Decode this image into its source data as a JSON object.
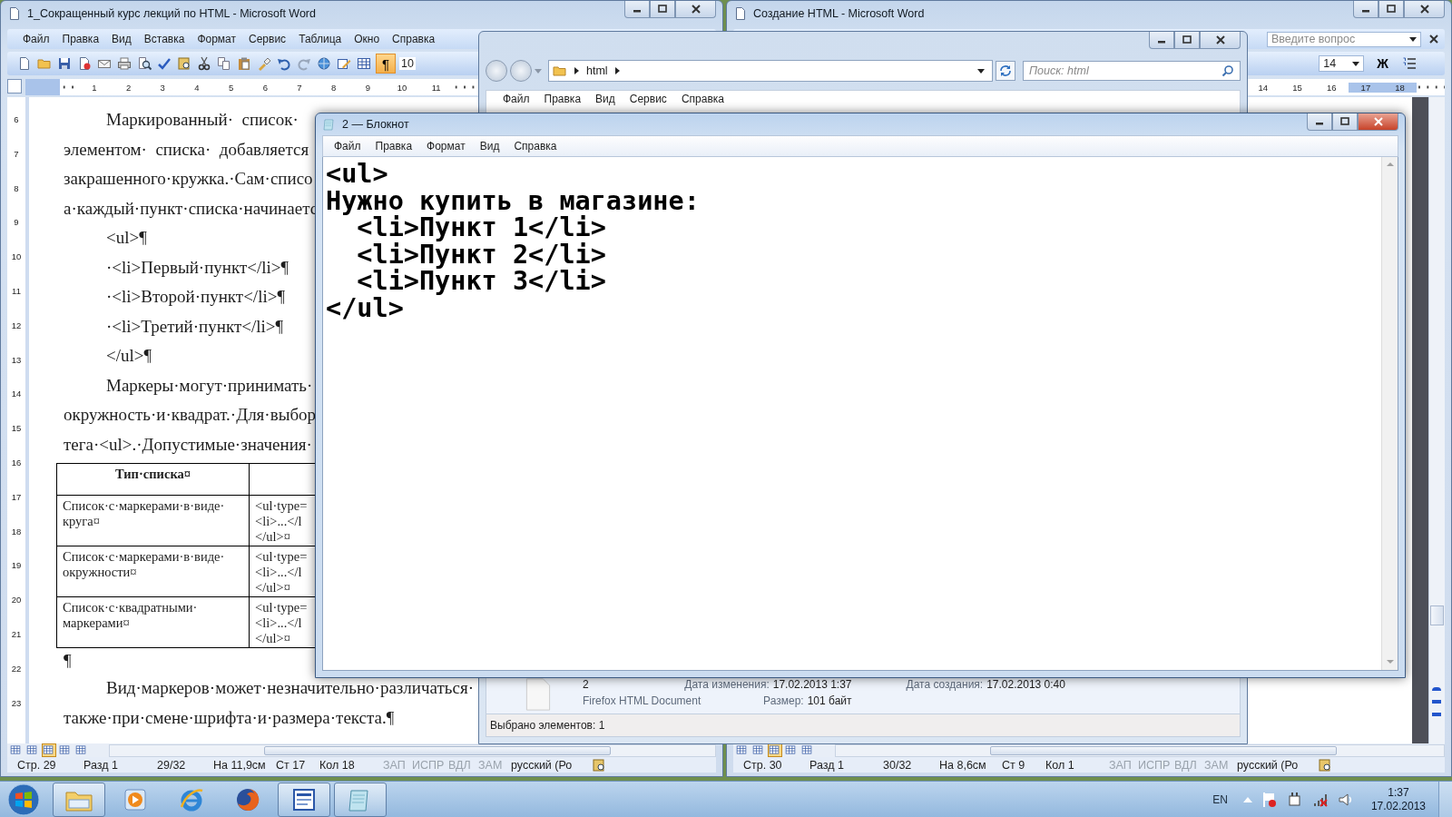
{
  "word_left": {
    "title": "1_Сокращенный курс лекций по HTML - Microsoft Word",
    "menu": [
      "Файл",
      "Правка",
      "Вид",
      "Вставка",
      "Формат",
      "Сервис",
      "Таблица",
      "Окно",
      "Справка"
    ],
    "show_marks": {
      "label": "¶",
      "on": true
    },
    "zoom": "10",
    "ruler": [
      "1",
      "2",
      "3",
      "4",
      "5",
      "6",
      "7",
      "8",
      "9",
      "10",
      "11"
    ],
    "vruler": [
      "6",
      "7",
      "8",
      "9",
      "10",
      "11",
      "12",
      "13",
      "14",
      "15",
      "16",
      "17",
      "18",
      "19",
      "20",
      "21",
      "22",
      "23"
    ],
    "lines_top": [
      {
        "text": "Маркированный·  список·",
        "indented": true
      },
      {
        "text": "элементом·  списка·  добавляется",
        "indented": false
      },
      {
        "text": "закрашенного·кружка.·Сам·списо",
        "indented": false
      },
      {
        "text": "а·каждый·пункт·списка·начинаетс",
        "indented": false
      },
      {
        "text": "<ul>¶",
        "indented": true
      },
      {
        "text": "·<li>Первый·пункт</li>¶",
        "indented": true
      },
      {
        "text": "·<li>Второй·пункт</li>¶",
        "indented": true
      },
      {
        "text": "·<li>Третий·пункт</li>¶",
        "indented": true
      },
      {
        "text": "</ul>¶",
        "indented": true
      },
      {
        "text": "Маркеры·могут·принимать·",
        "indented": true
      },
      {
        "text": "окружность·и·квадрат.·Для·выбор",
        "indented": false
      },
      {
        "text": "тега·<ul>.·Допустимые·значения·",
        "indented": false
      }
    ],
    "table": {
      "header": "Тип·списка¤",
      "rows": [
        {
          "type": "Список·с·маркерами·в·виде·круга¤",
          "code": [
            "<ul·type=",
            "<li>...</l",
            "</ul>¤"
          ]
        },
        {
          "type": "Список·с·маркерами·в·виде·окружности¤",
          "code": [
            "<ul·type=",
            "<li>...</l",
            "</ul>¤"
          ]
        },
        {
          "type": "Список·с·квадратными·маркерами¤",
          "code": [
            "<ul·type=",
            "<li>...</l",
            "</ul>¤"
          ]
        }
      ]
    },
    "lines_bottom": [
      {
        "text": "¶",
        "indented": false
      },
      {
        "text": "Вид·маркеров·может·незначительно·различаться·",
        "indented": true
      },
      {
        "text": "также·при·смене·шрифта·и·размера·текста.¶",
        "indented": false
      }
    ],
    "views": [
      {
        "selected": false
      },
      {
        "selected": false
      },
      {
        "selected": true
      },
      {
        "selected": false
      },
      {
        "selected": false
      }
    ],
    "status": [
      {
        "text": "Стр. 29",
        "disabled": false
      },
      {
        "text": "Разд 1",
        "disabled": false
      },
      {
        "text": "29/32",
        "disabled": false
      },
      {
        "text": "На 11,9см",
        "disabled": false
      },
      {
        "text": "Ст 17",
        "disabled": false
      },
      {
        "text": "Кол 18",
        "disabled": false
      },
      {
        "text": "ЗАП",
        "disabled": true
      },
      {
        "text": "ИСПР",
        "disabled": true
      },
      {
        "text": "ВДЛ",
        "disabled": true
      },
      {
        "text": "ЗАМ",
        "disabled": true
      },
      {
        "text": "русский (Ро",
        "disabled": false
      }
    ]
  },
  "word_right": {
    "title": "Создание HTML - Microsoft Word",
    "help_placeholder": "Введите вопрос",
    "font_size": "14",
    "bold_label": "Ж",
    "ruler": [
      "14",
      "15",
      "16",
      "17",
      "18"
    ],
    "views": [
      {
        "selected": false
      },
      {
        "selected": false
      },
      {
        "selected": true
      },
      {
        "selected": false
      },
      {
        "selected": false
      }
    ],
    "status": [
      {
        "text": "Стр. 30",
        "disabled": false
      },
      {
        "text": "Разд 1",
        "disabled": false
      },
      {
        "text": "30/32",
        "disabled": false
      },
      {
        "text": "На 8,6см",
        "disabled": false
      },
      {
        "text": "Ст 9",
        "disabled": false
      },
      {
        "text": "Кол 1",
        "disabled": false
      },
      {
        "text": "ЗАП",
        "disabled": true
      },
      {
        "text": "ИСПР",
        "disabled": true
      },
      {
        "text": "ВДЛ",
        "disabled": true
      },
      {
        "text": "ЗАМ",
        "disabled": true
      },
      {
        "text": "русский (Ро",
        "disabled": false
      }
    ]
  },
  "explorer": {
    "breadcrumb": "html",
    "search_placeholder": "Поиск: html",
    "menu": [
      "Файл",
      "Правка",
      "Вид",
      "Сервис",
      "Справка"
    ],
    "details": {
      "name": "2",
      "type": "Firefox HTML Document",
      "modified_label": "Дата изменения:",
      "modified": "17.02.2013 1:37",
      "created_label": "Дата создания:",
      "created": "17.02.2013 0:40",
      "size_label": "Размер:",
      "size": "101 байт"
    },
    "status": "Выбрано элементов: 1"
  },
  "notepad": {
    "title": "2 — Блокнот",
    "menu": [
      "Файл",
      "Правка",
      "Формат",
      "Вид",
      "Справка"
    ],
    "lines": [
      "<ul>",
      "Нужно купить в магазине:",
      "  <li>Пункт 1</li>",
      "  <li>Пункт 2</li>",
      "  <li>Пункт 3</li>",
      "</ul>"
    ]
  },
  "taskbar": {
    "items": [
      {
        "kind": "folder",
        "running": true
      },
      {
        "kind": "media",
        "running": false
      },
      {
        "kind": "ring",
        "running": false
      },
      {
        "kind": "globe",
        "running": false
      },
      {
        "kind": "word",
        "running": true
      },
      {
        "kind": "notepad",
        "running": true
      }
    ],
    "language": "EN",
    "time": "1:37",
    "date": "17.02.2013"
  }
}
